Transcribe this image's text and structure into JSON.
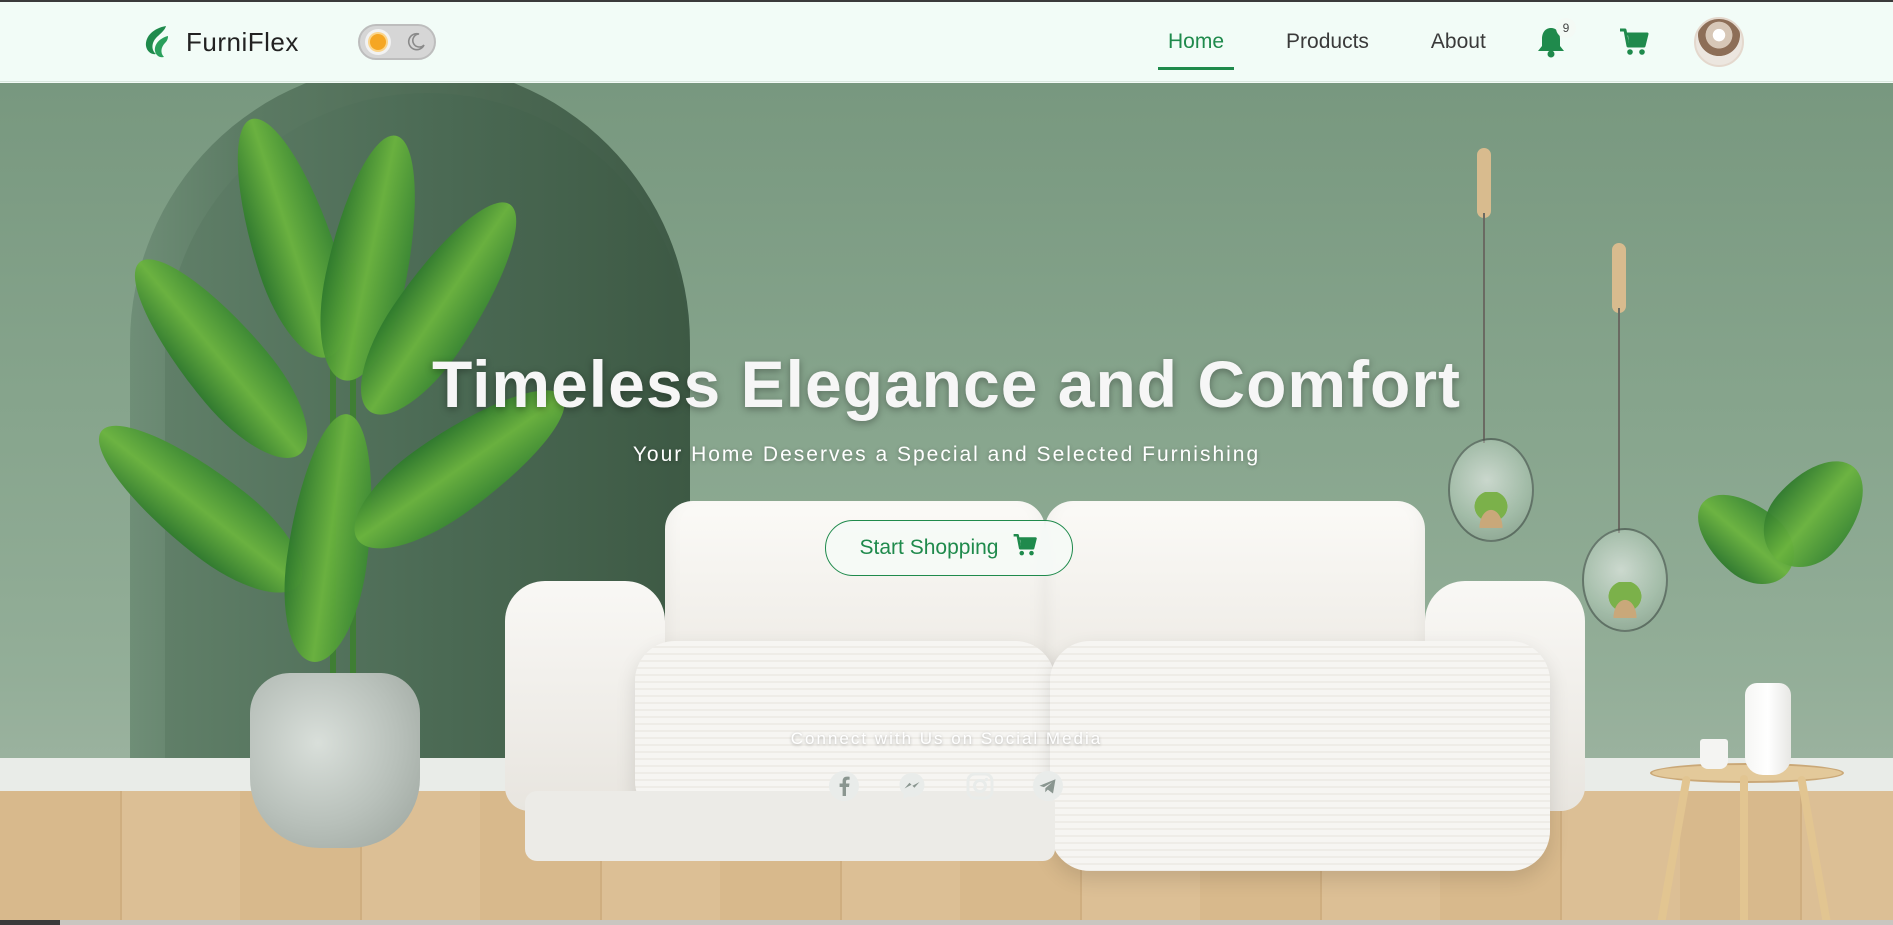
{
  "brand": {
    "name": "FurniFlex",
    "accent": "#1f8a4c"
  },
  "theme_toggle": {
    "light_icon": "sun-icon",
    "dark_icon": "moon-icon"
  },
  "nav": {
    "items": [
      {
        "label": "Home",
        "active": true
      },
      {
        "label": "Products",
        "active": false
      },
      {
        "label": "About",
        "active": false
      }
    ],
    "notifications": {
      "icon": "bell-icon",
      "count": "9"
    },
    "cart": {
      "icon": "cart-icon"
    },
    "avatar": {
      "icon": "avatar"
    }
  },
  "hero": {
    "title": "Timeless Elegance and Comfort",
    "subtitle": "Your Home Deserves a Special and Selected Furnishing",
    "cta_label": "Start Shopping",
    "cta_icon": "cart-icon"
  },
  "social": {
    "title": "Connect with Us on Social Media",
    "icons": [
      "facebook-icon",
      "messenger-icon",
      "instagram-icon",
      "telegram-icon"
    ]
  }
}
